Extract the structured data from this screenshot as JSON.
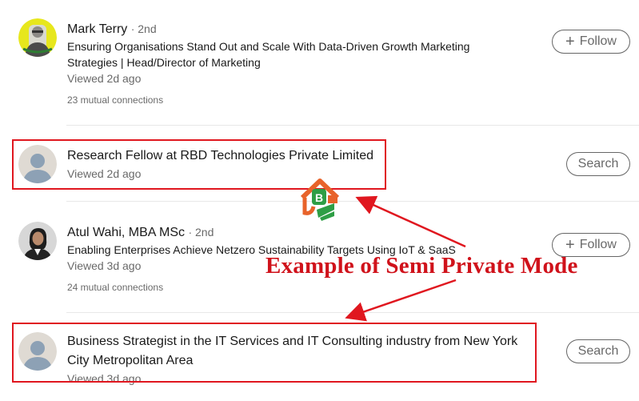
{
  "profiles": [
    {
      "name": "Mark Terry",
      "degree": "· 2nd",
      "headline": "Ensuring Organisations Stand Out and Scale With Data-Driven Growth Marketing Strategies | Head/Director of Marketing",
      "viewed": "Viewed 2d ago",
      "mutual": "23 mutual connections",
      "button": "Follow"
    },
    {
      "title": "Research Fellow at RBD Technologies Private Limited",
      "viewed": "Viewed 2d ago",
      "button": "Search"
    },
    {
      "name": "Atul Wahi, MBA MSc",
      "degree": "· 2nd",
      "headline": "Enabling Enterprises Achieve Netzero Sustainability Targets Using IoT & SaaS",
      "viewed": "Viewed 3d ago",
      "mutual": "24 mutual connections",
      "button": "Follow"
    },
    {
      "title": "Business Strategist in the IT Services and IT Consulting industry from New York City Metropolitan Area",
      "viewed": "Viewed 3d ago",
      "button": "Search"
    }
  ],
  "annotation": "Example of Semi Private Mode",
  "icons": {
    "follow": "plus-icon",
    "avatar_generic": "person-silhouette-icon",
    "watermark": "logo-icon"
  },
  "colors": {
    "annotation_red": "#d0121b",
    "box_red": "#e0171f",
    "avatar_yellow": "#e7e71d",
    "placeholder_bg": "#dfdad3",
    "placeholder_fg": "#8da1b5"
  }
}
